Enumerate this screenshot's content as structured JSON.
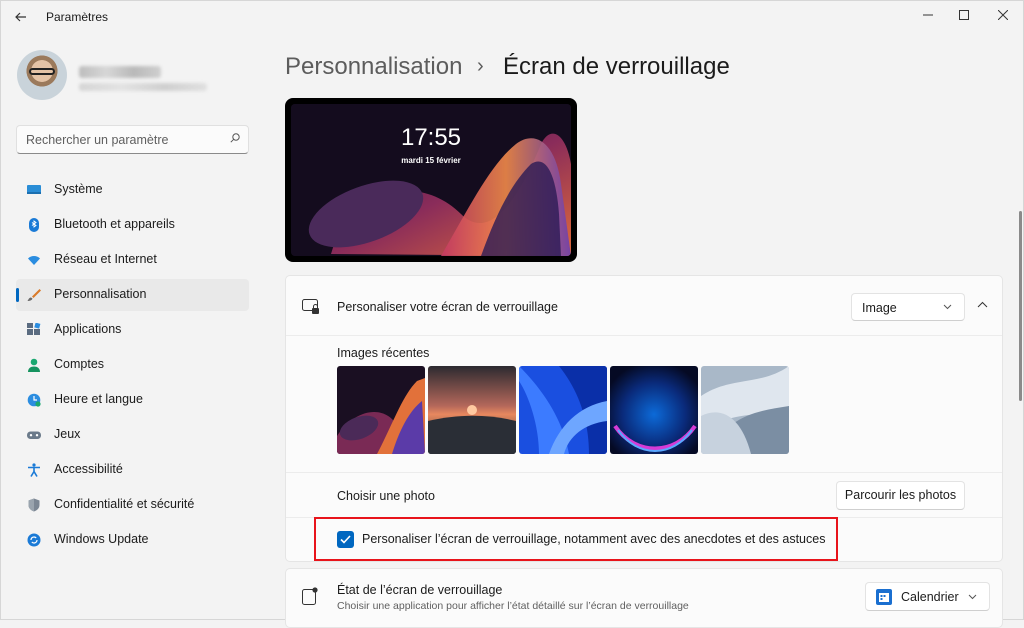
{
  "window": {
    "title": "Paramètres",
    "controls": {
      "minimize": "—",
      "maximize": "☐",
      "close": "✕"
    }
  },
  "search": {
    "placeholder": "Rechercher un paramètre"
  },
  "sidebar": {
    "items": [
      {
        "label": "Système",
        "icon": "system-icon"
      },
      {
        "label": "Bluetooth et appareils",
        "icon": "bluetooth-icon"
      },
      {
        "label": "Réseau et Internet",
        "icon": "wifi-icon"
      },
      {
        "label": "Personnalisation",
        "icon": "brush-icon",
        "active": true
      },
      {
        "label": "Applications",
        "icon": "apps-icon"
      },
      {
        "label": "Comptes",
        "icon": "accounts-icon"
      },
      {
        "label": "Heure et langue",
        "icon": "time-language-icon"
      },
      {
        "label": "Jeux",
        "icon": "gaming-icon"
      },
      {
        "label": "Accessibilité",
        "icon": "accessibility-icon"
      },
      {
        "label": "Confidentialité et sécurité",
        "icon": "shield-icon"
      },
      {
        "label": "Windows Update",
        "icon": "update-icon"
      }
    ]
  },
  "header": {
    "breadcrumb_parent": "Personnalisation",
    "separator": "›",
    "breadcrumb_current": "Écran de verrouillage"
  },
  "preview": {
    "time": "17:55",
    "date": "mardi 15 février"
  },
  "lock_screen": {
    "title": "Personaliser votre écran de verrouillage",
    "dropdown_value": "Image",
    "recent_images_label": "Images récentes",
    "choose_photo_label": "Choisir une photo",
    "browse_button": "Parcourir les photos",
    "checkbox_label": "Personaliser l’écran de verrouillage, notamment avec des anecdotes et des astuces",
    "checkbox_checked": true
  },
  "status": {
    "title": "État de l’écran de verrouillage",
    "subtitle": "Choisir une application pour afficher l’état détaillé sur l’écran de verrouillage",
    "dropdown_value": "Calendrier"
  },
  "colors": {
    "accent": "#0067c0",
    "highlight_box": "#e8141b"
  }
}
